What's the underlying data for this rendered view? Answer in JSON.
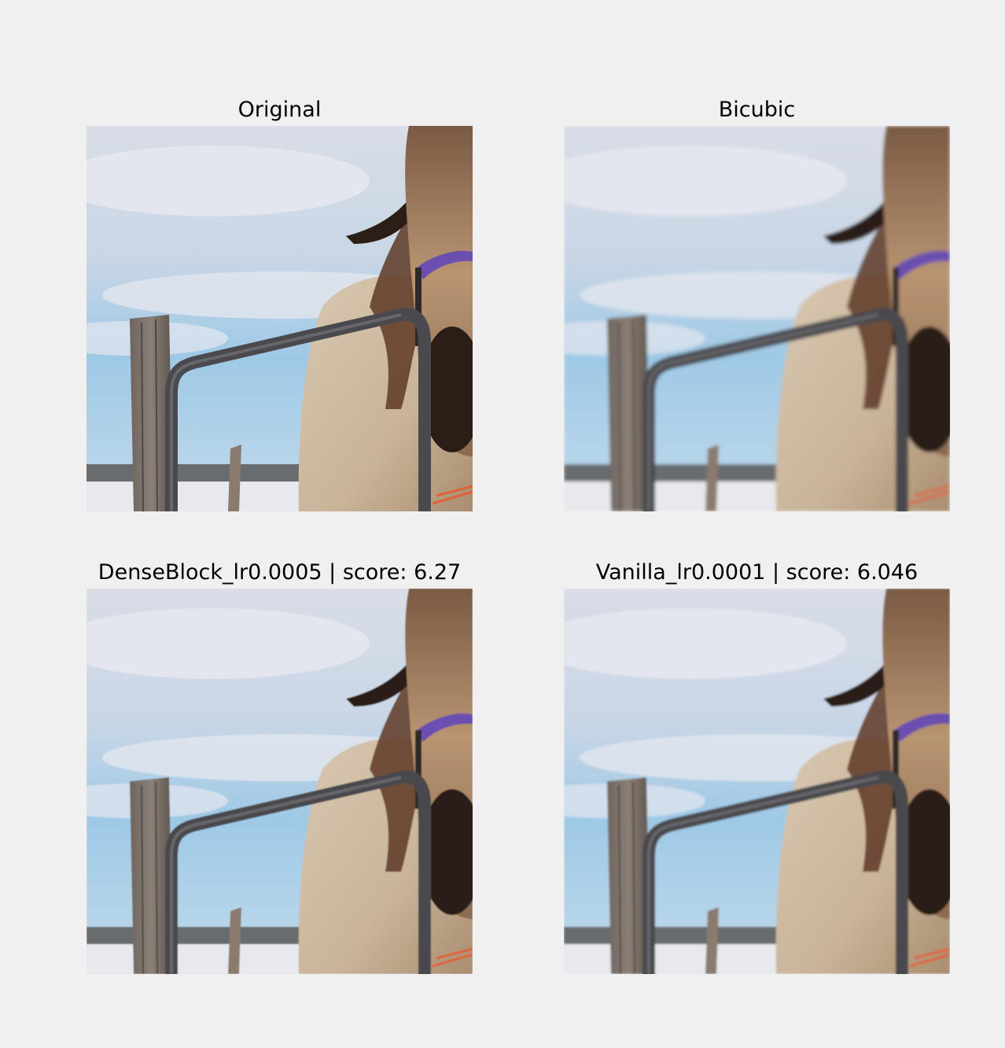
{
  "figure": {
    "panels": [
      {
        "title": "Original"
      },
      {
        "title": "Bicubic"
      },
      {
        "title": "DenseBlock_lr0.0005 | score: 6.27"
      },
      {
        "title": "Vanilla_lr0.0001 | score: 6.046"
      }
    ]
  },
  "scene": {
    "description_icon": "horse-at-gate-photo",
    "colors": {
      "sky_top": "#d9dde6",
      "sky_blue": "#9ec9e6",
      "snow": "#e8e9ee",
      "horse_coat": "#c9b49a",
      "horse_dark": "#2a1e17",
      "halter": "#6a4fb0",
      "gate_bar": "#4a4a4e",
      "post": "#8a8078",
      "figure_background": "#f0f0f0"
    }
  }
}
